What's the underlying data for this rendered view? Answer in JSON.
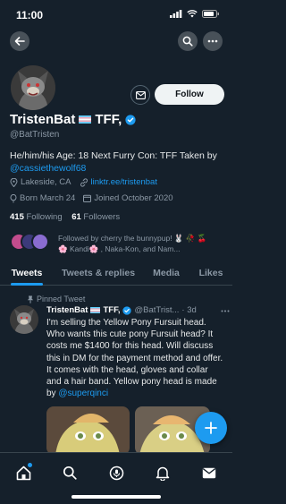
{
  "status_bar": {
    "time": "11:00"
  },
  "profile": {
    "follow_label": "Follow",
    "display_name": "TristenBat",
    "name_suffix": "TFF,",
    "handle": "@BatTristen",
    "bio_text": "He/him/his Age: 18 Next Furry Con: TFF Taken by ",
    "bio_mention": "@cassiethewolf68",
    "location": "Lakeside, CA",
    "website": "linktr.ee/tristenbat",
    "born": "Born March 24",
    "joined": "Joined October 2020",
    "following_count": "415",
    "following_label": "Following",
    "followers_count": "61",
    "followers_label": "Followers",
    "followed_by_line1": "Followed by cherry the bunnypup! 🐰 🥀 🍒",
    "followed_by_line2": "🌸 Kandi🌸 ,  Naka-Kon, and Nam..."
  },
  "tabs": [
    {
      "label": "Tweets"
    },
    {
      "label": "Tweets & replies"
    },
    {
      "label": "Media"
    },
    {
      "label": "Likes"
    }
  ],
  "pinned_tweet": {
    "pinned_label": "Pinned Tweet",
    "author_name": "TristenBat",
    "author_suffix": "TFF,",
    "author_handle": "@BatTrist...",
    "time": "· 3d",
    "text": "I'm selling the Yellow Pony Fursuit head. Who wants this cute pony Fursuit head? It costs me $1400 for this head. Will discuss this in DM for the payment method and offer. It comes with the head, gloves and collar and a hair band. Yellow pony head is made by ",
    "mention": "@superqinci"
  },
  "colors": {
    "background": "#15202b",
    "accent": "#1d9bf0",
    "secondary_text": "#8b98a5",
    "verified": "#1d9bf0"
  },
  "icons": [
    "back-arrow-icon",
    "search-icon",
    "more-icon",
    "mail-icon",
    "verified-icon",
    "location-icon",
    "link-icon",
    "balloon-icon",
    "calendar-icon",
    "pin-icon",
    "compose-icon",
    "home-icon",
    "spaces-icon",
    "notifications-icon",
    "messages-icon"
  ]
}
